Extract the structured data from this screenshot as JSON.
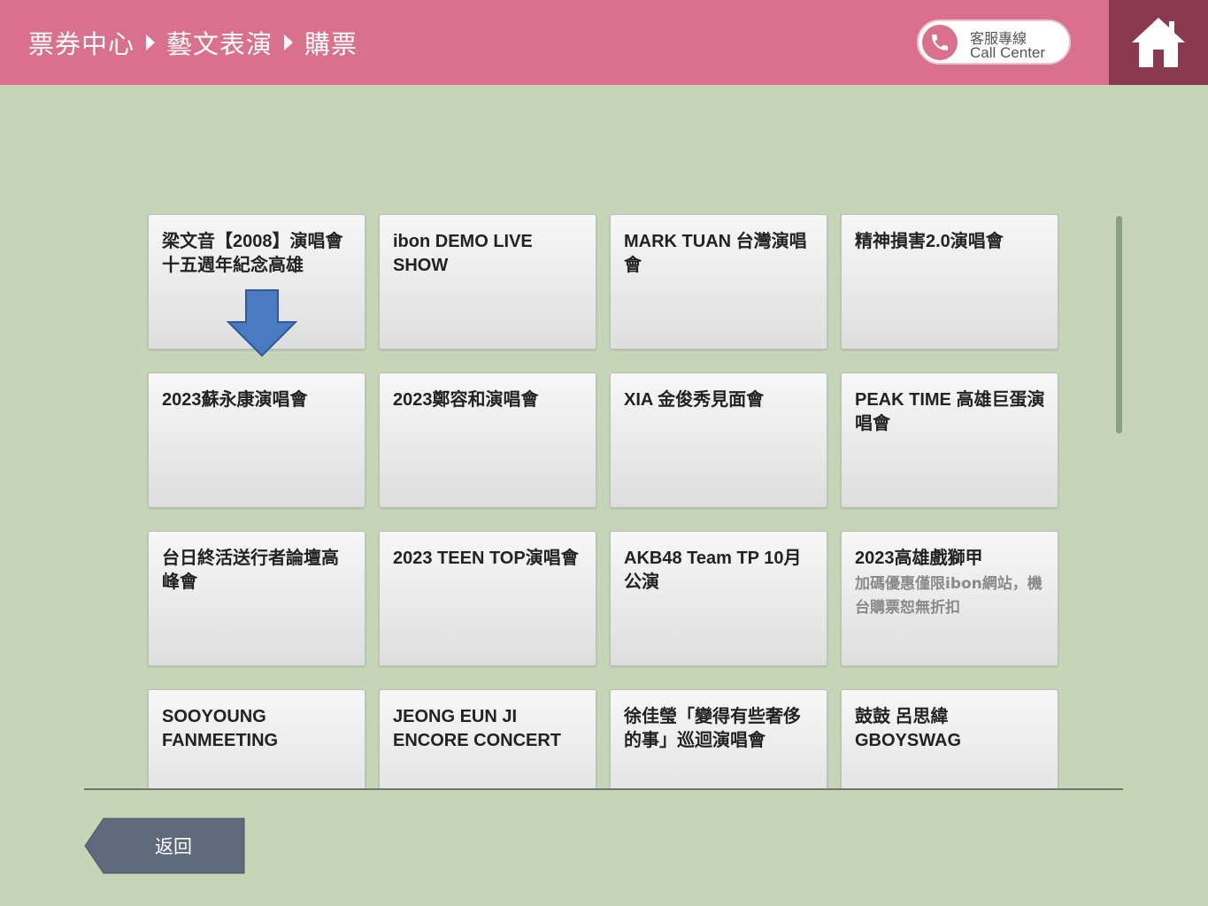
{
  "header": {
    "breadcrumb": [
      "票券中心",
      "藝文表演",
      "購票"
    ],
    "call_center": {
      "zh": "客服專線",
      "en": "Call Center"
    },
    "home_icon": "home-icon",
    "colors": {
      "header_bg": "#d9708c",
      "home_bg": "#8a3a4c",
      "page_bg": "#c5d5b6"
    }
  },
  "events": [
    {
      "title": "梁文音【2008】演唱會十五週年紀念高雄"
    },
    {
      "title": "ibon DEMO LIVE SHOW"
    },
    {
      "title": "MARK TUAN 台灣演唱會"
    },
    {
      "title": "精神損害2.0演唱會"
    },
    {
      "title": "2023蘇永康演唱會"
    },
    {
      "title": "2023鄭容和演唱會"
    },
    {
      "title": "XIA 金俊秀見面會"
    },
    {
      "title": "PEAK TIME 高雄巨蛋演唱會"
    },
    {
      "title": "台日終活送行者論壇高峰會"
    },
    {
      "title": "2023 TEEN TOP演唱會"
    },
    {
      "title": "AKB48 Team TP 10月公演"
    },
    {
      "title": "2023高雄戲獅甲",
      "subtitle": "加碼優惠僅限ibon網站，機台購票恕無折扣"
    },
    {
      "title": "SOOYOUNG FANMEETING"
    },
    {
      "title": "JEONG EUN JI ENCORE CONCERT"
    },
    {
      "title": "徐佳瑩「變得有些奢侈的事」巡迴演唱會"
    },
    {
      "title": "鼓鼓 呂思緯 GBOYSWAG"
    }
  ],
  "footer": {
    "back_label": "返回"
  }
}
